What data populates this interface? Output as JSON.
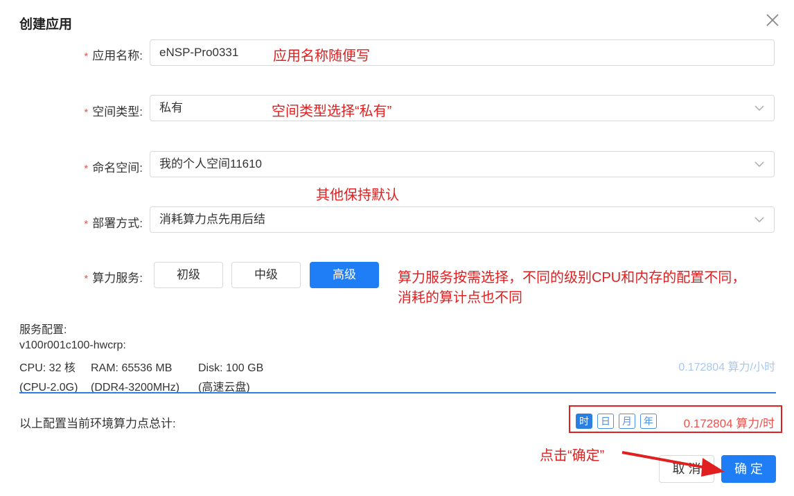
{
  "dialog": {
    "title": "创建应用"
  },
  "form": {
    "app_name": {
      "label": "应用名称:",
      "value": "eNSP-Pro0331"
    },
    "space_type": {
      "label": "空间类型:",
      "value": "私有"
    },
    "namespace": {
      "label": "命名空间:",
      "value": "我的个人空间11610"
    },
    "deploy_mode": {
      "label": "部署方式:",
      "value": "消耗算力点先用后结"
    },
    "compute_service": {
      "label": "算力服务:",
      "options": [
        "初级",
        "中级",
        "高级"
      ],
      "selected": "高级"
    }
  },
  "annotations": {
    "app_name_note": "应用名称随便写",
    "space_type_note": "空间类型选择“私有”",
    "default_note": "其他保持默认",
    "service_note_line1": "算力服务按需选择，不同的级别CPU和内存的配置不同，",
    "service_note_line2": "消耗的算计点也不同",
    "confirm_note": "点击“确定”"
  },
  "service_config": {
    "heading": "服务配置:",
    "spec_id": "v100r001c100-hwcrp:",
    "cpu": "CPU: 32 核",
    "ram": "RAM: 65536 MB",
    "disk": "Disk: 100 GB",
    "cpu_detail": "(CPU-2.0G)",
    "ram_detail": "(DDR4-3200MHz)",
    "disk_detail": "(高速云盘)",
    "rate": "0.172804 算力/小时"
  },
  "total": {
    "label": "以上配置当前环境算力点总计:",
    "periods": [
      "时",
      "日",
      "月",
      "年"
    ],
    "selected_period": "时",
    "value": "0.172804 算力/时"
  },
  "footer": {
    "cancel_label": "取 消",
    "ok_label": "确 定"
  },
  "colors": {
    "primary": "#1f7ef5",
    "annotation": "#e02020",
    "required": "#e8534d"
  }
}
